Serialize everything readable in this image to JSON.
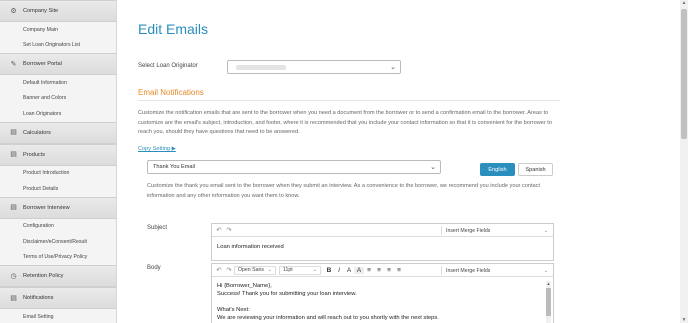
{
  "sidebar": {
    "sections": [
      {
        "label": "Company Site",
        "icon": "gear-icon",
        "items": [
          "Company Main",
          "Set Loan Originators List"
        ]
      },
      {
        "label": "Borrower Portal",
        "icon": "wrench-icon",
        "items": [
          "Default Information",
          "Banner and Colors",
          "Loan Originators"
        ]
      },
      {
        "label": "Calculators",
        "icon": "document-icon",
        "items": []
      },
      {
        "label": "Products",
        "icon": "document-icon",
        "items": [
          "Product Introduction",
          "Product Details"
        ]
      },
      {
        "label": "Borrower Interview",
        "icon": "document-icon",
        "items": [
          "Configuration",
          "Disclaimer/eConsent/Result",
          "Terms of Use/Privacy Policy"
        ]
      },
      {
        "label": "Retention Policy",
        "icon": "clock-icon",
        "items": []
      },
      {
        "label": "Notifications",
        "icon": "document-icon",
        "items": [
          "Email Setting"
        ]
      }
    ]
  },
  "main": {
    "title": "Edit Emails",
    "select_lo_label": "Select Loan Originator",
    "section_title": "Email Notifications",
    "intro": "Customize the notification emails that are sent to the borrower when you need a document from the borrower or to send a confirmation email to the borrower. Areas to customize are the email's subject, introduction, and footer, where it is recommended that you include your contact information so that it is convenient for the borrower to reach you, should they have questions that need to be answered.",
    "copy_setting": "Copy Setting ▶",
    "email_select": "Thank You Email",
    "tabs": {
      "english": "English",
      "spanish": "Spanish"
    },
    "email_desc": "Customize the thank you email sent to the borrower when they submit an interview. As a convenience to the borrower, we recommend you include your contact information and any other information you want them to know.",
    "subject_label": "Subject",
    "subject_value": "Loan information received",
    "body_label": "Body",
    "merge_fields": "Insert Merge Fields",
    "font_name": "Open Sans",
    "font_size": "11pt",
    "body_lines": [
      "Hi {Borrower_Name},",
      "Success! Thank you for submitting your loan interview.",
      "",
      "What's Next:",
      "We are reviewing your information and will reach out to you shortly with the next steps."
    ]
  }
}
